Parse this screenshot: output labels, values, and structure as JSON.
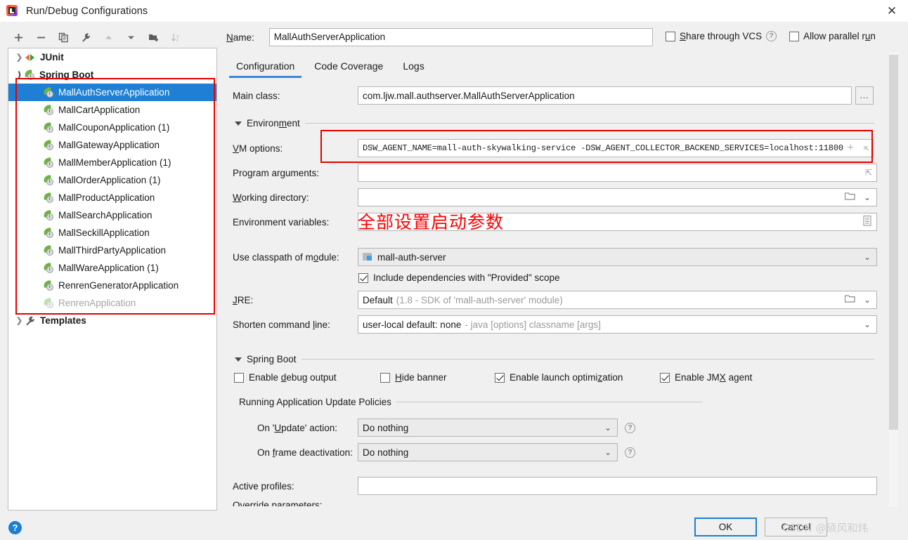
{
  "window": {
    "title": "Run/Debug Configurations",
    "app_icon": "intellij-idea-icon",
    "close_label": "✕"
  },
  "toolbar": {
    "items": [
      {
        "name": "add-configuration-button",
        "icon": "plus-icon",
        "enabled": true
      },
      {
        "name": "remove-configuration-button",
        "icon": "minus-icon",
        "enabled": true
      },
      {
        "name": "copy-configuration-button",
        "icon": "copy-icon",
        "enabled": true
      },
      {
        "name": "edit-templates-button",
        "icon": "wrench-icon",
        "enabled": true
      },
      {
        "name": "move-up-button",
        "icon": "arrow-up-icon",
        "enabled": false
      },
      {
        "name": "move-down-button",
        "icon": "arrow-down-icon",
        "enabled": true
      },
      {
        "name": "move-into-folder-button",
        "icon": "folder-add-icon",
        "enabled": true
      },
      {
        "name": "sort-alphabetically-button",
        "icon": "sort-az-icon",
        "enabled": false
      }
    ]
  },
  "tree": {
    "groups": [
      {
        "label": "JUnit",
        "icon": "junit-icon",
        "expanded": false
      },
      {
        "label": "Spring Boot",
        "icon": "spring-boot-icon",
        "expanded": true
      }
    ],
    "items": [
      {
        "label": "MallAuthServerApplication",
        "selected": true,
        "disabled": false
      },
      {
        "label": "MallCartApplication",
        "selected": false,
        "disabled": false
      },
      {
        "label": "MallCouponApplication (1)",
        "selected": false,
        "disabled": false
      },
      {
        "label": "MallGatewayApplication",
        "selected": false,
        "disabled": false
      },
      {
        "label": "MallMemberApplication (1)",
        "selected": false,
        "disabled": false
      },
      {
        "label": "MallOrderApplication (1)",
        "selected": false,
        "disabled": false
      },
      {
        "label": "MallProductApplication",
        "selected": false,
        "disabled": false
      },
      {
        "label": "MallSearchApplication",
        "selected": false,
        "disabled": false
      },
      {
        "label": "MallSeckillApplication",
        "selected": false,
        "disabled": false
      },
      {
        "label": "MallThirdPartyApplication",
        "selected": false,
        "disabled": false
      },
      {
        "label": "MallWareApplication (1)",
        "selected": false,
        "disabled": false
      },
      {
        "label": "RenrenGeneratorApplication",
        "selected": false,
        "disabled": false
      },
      {
        "label": "RenrenApplication",
        "selected": false,
        "disabled": true
      }
    ],
    "templates": {
      "label": "Templates",
      "icon": "wrench-icon",
      "expanded": false
    }
  },
  "name_field": {
    "label": "Name:",
    "value": "MallAuthServerApplication"
  },
  "options": {
    "share_label": "Share through VCS",
    "share_checked": false,
    "share_help_icon": "question-icon",
    "parallel_label": "Allow parallel run",
    "parallel_checked": false
  },
  "tabs": [
    {
      "label": "Configuration",
      "active": true
    },
    {
      "label": "Code Coverage",
      "active": false
    },
    {
      "label": "Logs",
      "active": false
    }
  ],
  "config": {
    "main_class_label": "Main class:",
    "main_class_value": "com.ljw.mall.authserver.MallAuthServerApplication",
    "browse_button_label": "...",
    "environment_group": "Environment",
    "vm_options_label": "VM options:",
    "vm_options_value": "DSW_AGENT_NAME=mall-auth-skywalking-service -DSW_AGENT_COLLECTOR_BACKEND_SERVICES=localhost:11800",
    "program_arguments_label": "Program arguments:",
    "program_arguments_value": "",
    "working_directory_label": "Working directory:",
    "working_directory_value": "",
    "environment_variables_label": "Environment variables:",
    "environment_variables_value": "",
    "classpath_label": "Use classpath of module:",
    "classpath_value": "mall-auth-server",
    "include_provided_label": "Include dependencies with \"Provided\" scope",
    "include_provided_checked": true,
    "jre_label": "JRE:",
    "jre_value": "Default",
    "jre_hint": "(1.8 - SDK of 'mall-auth-server' module)",
    "shorten_label": "Shorten command line:",
    "shorten_value": "user-local default: none",
    "shorten_hint": "- java [options] classname [args]"
  },
  "spring_boot": {
    "group_label": "Spring Boot",
    "checkboxes": [
      {
        "label": "Enable debug output",
        "checked": false
      },
      {
        "label": "Hide banner",
        "checked": false
      },
      {
        "label": "Enable launch optimization",
        "checked": true
      },
      {
        "label": "Enable JMX agent",
        "checked": true
      }
    ],
    "policies_label": "Running Application Update Policies",
    "on_update_label": "On 'Update' action:",
    "on_update_value": "Do nothing",
    "on_frame_label": "On frame deactivation:",
    "on_frame_value": "Do nothing",
    "active_profiles_label": "Active profiles:",
    "active_profiles_value": "",
    "override_parameters_label": "Override parameters:"
  },
  "annotation": {
    "text": "全部设置启动参数",
    "color": "#ff0000"
  },
  "footer": {
    "help_label": "?",
    "ok_label": "OK",
    "cancel_label": "Cancel",
    "watermark": "CSDN @硕风和炜"
  },
  "colors": {
    "selection": "#1e7fd4",
    "accent": "#3d87d9",
    "highlight_box": "#e60000",
    "spring_green": "#6db33f"
  }
}
